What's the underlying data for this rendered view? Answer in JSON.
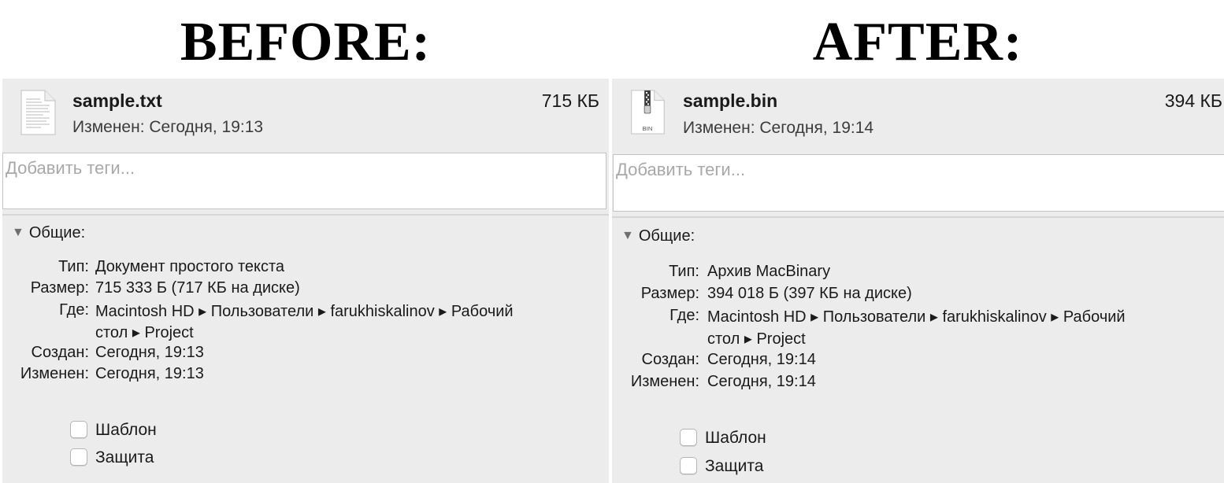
{
  "headings": {
    "before": "BEFORE:",
    "after": "AFTER:"
  },
  "before": {
    "file_name": "sample.txt",
    "file_size": "715 КБ",
    "modified_summary": "Изменен: Сегодня, 19:13",
    "icon": "text-document-icon",
    "tags_placeholder": "Добавить теги...",
    "section_title": "Общие:",
    "info": {
      "type_label": "Тип:",
      "type_value": "Документ простого текста",
      "size_label": "Размер:",
      "size_value": "715 333 Б (717 КБ на диске)",
      "where_label": "Где:",
      "where_value_line1": "Macintosh HD ▸ Пользователи ▸ farukhiskalinov ▸ Рабочий",
      "where_value_line2": "стол ▸ Project",
      "created_label": "Создан:",
      "created_value": "Сегодня, 19:13",
      "modified_label": "Изменен:",
      "modified_value": "Сегодня, 19:13"
    },
    "checkboxes": {
      "template_label": "Шаблон",
      "template_checked": false,
      "locked_label": "Защита",
      "locked_checked": false
    }
  },
  "after": {
    "file_name": "sample.bin",
    "file_size": "394 КБ",
    "modified_summary": "Изменен: Сегодня, 19:14",
    "icon": "bin-archive-icon",
    "icon_label": "BIN",
    "tags_placeholder": "Добавить теги...",
    "section_title": "Общие:",
    "info": {
      "type_label": "Тип:",
      "type_value": "Архив MacBinary",
      "size_label": "Размер:",
      "size_value": "394 018 Б (397 КБ на диске)",
      "where_label": "Где:",
      "where_value_line1": "Macintosh HD ▸ Пользователи ▸ farukhiskalinov ▸ Рабочий",
      "where_value_line2": "стол ▸ Project",
      "created_label": "Создан:",
      "created_value": "Сегодня, 19:14",
      "modified_label": "Изменен:",
      "modified_value": "Сегодня, 19:14"
    },
    "checkboxes": {
      "template_label": "Шаблон",
      "template_checked": false,
      "locked_label": "Защита",
      "locked_checked": false
    }
  },
  "colors": {
    "panel_background": "#ececec",
    "placeholder": "#a8a8a8",
    "text": "#1a1a1a"
  }
}
